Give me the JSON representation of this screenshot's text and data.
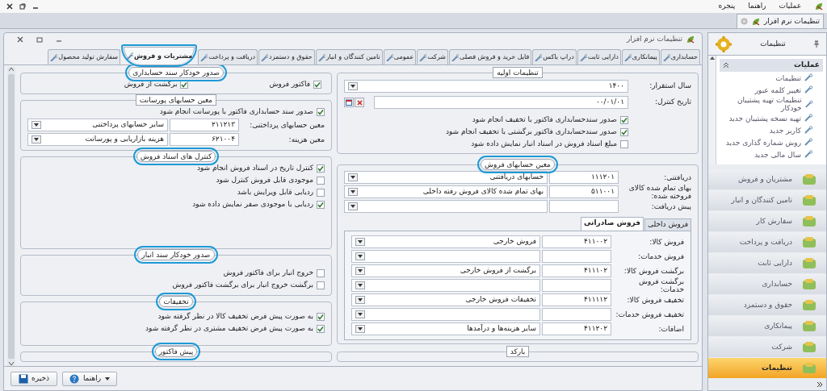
{
  "menu": [
    "عملیات",
    "راهنما",
    "پنجره"
  ],
  "doc_tab": {
    "title": "تنظیمات نرم افزار"
  },
  "window": {
    "title": "تنظیمات نرم افزار"
  },
  "tabs": [
    {
      "label": "حسابداری",
      "selected": false
    },
    {
      "label": "پیمانکاری",
      "selected": false
    },
    {
      "label": "دارایی ثابت",
      "selected": false
    },
    {
      "label": "دراپ باکس",
      "selected": false
    },
    {
      "label": "فایل خرید و فروش فصلی",
      "selected": false
    },
    {
      "label": "شرکت",
      "selected": false
    },
    {
      "label": "عمومی",
      "selected": false
    },
    {
      "label": "تامین کنندگان و انبار",
      "selected": false
    },
    {
      "label": "حقوق و دستمزد",
      "selected": false
    },
    {
      "label": "دریافت و پرداخت",
      "selected": false
    },
    {
      "label": "مشتریات و فروش",
      "selected": true,
      "highlighted": true
    },
    {
      "label": "سفارش تولید محصول",
      "selected": false
    }
  ],
  "initial_settings": {
    "legend": "تنظیمات اولیه",
    "highlighted": false,
    "fields": [
      {
        "kind": "dropdown",
        "label": "سال استقرار:",
        "value": "۱۴۰۰"
      },
      {
        "kind": "date",
        "label": "تاریخ کنترل:",
        "value": "۰۰/۰۱/۰۱"
      }
    ],
    "checks": [
      {
        "label": "صدور سندحسابداری فاکتور با تخفیف انجام شود",
        "checked": true
      },
      {
        "label": "صدور سندحسابداری فاکتور برگشتی با تخفیف انجام شود",
        "checked": true
      },
      {
        "label": "مبلغ اسناد فروش در اسناد انبار نمایش داده شود",
        "checked": false
      }
    ]
  },
  "sales_accounts": {
    "legend": "معین حسابهای فروش",
    "highlighted": true,
    "rows": [
      {
        "label": "دریافتنی:",
        "code": "۱۱۱۲۰۱",
        "name": "حسابهای دریافتنی"
      },
      {
        "label": "بهای تمام شده کالای فروخته شده:",
        "code": "۵۱۱۰۰۱",
        "name": "بهای تمام شده کالای فروش رفته داخلی"
      },
      {
        "label": "پیش دریافت:",
        "code": "",
        "name": ""
      }
    ],
    "subtabs": [
      {
        "label": "فروش داخلی",
        "selected": false
      },
      {
        "label": "فروش صادراتی",
        "selected": true
      }
    ],
    "export_rows": [
      {
        "label": "فروش کالا:",
        "code": "۴۱۱۰۰۲",
        "name": "فروش  خارجی"
      },
      {
        "label": "فروش خدمات:",
        "code": "",
        "name": ""
      },
      {
        "label": "برگشت فروش کالا:",
        "code": "۴۱۱۱۰۲",
        "name": "برگشت از فروش  خارجی"
      },
      {
        "label": "برگشت فروش خدمات:",
        "code": "",
        "name": ""
      },
      {
        "label": "تخفیف فروش کالا:",
        "code": "۴۱۱۱۱۲",
        "name": "تخفیفات فروش خارجی"
      },
      {
        "label": "تخفیف فروش خدمات:",
        "code": "",
        "name": ""
      },
      {
        "label": "اضافات:",
        "code": "۴۱۱۲۰۲",
        "name": "سایر هزینه‌ها و درآمدها"
      }
    ]
  },
  "barcode": {
    "legend": "بارکد",
    "highlighted": false
  },
  "auto_voucher": {
    "legend": "صدور خودکار سند حسابداری",
    "highlighted": true,
    "checks": [
      {
        "label": "فاکتور فروش",
        "checked": true
      },
      {
        "label": "برگشت از فروش",
        "checked": true
      }
    ]
  },
  "commission": {
    "legend": "معین حسابهای پورسانت",
    "highlighted": false,
    "checks": [
      {
        "label": "صدور سند حسابداری فاکتور با پورسانت انجام شود",
        "checked": true
      }
    ],
    "rows": [
      {
        "label": "معین حسابهای پرداختنی:",
        "code": "۲۱۱۲۱۳",
        "name": "سایر حسابهای پرداختنی"
      },
      {
        "label": "معین هزینه:",
        "code": "۶۲۱۰۰۴",
        "name": "هزینه بازاریابی و پورسانت"
      }
    ]
  },
  "sales_controls": {
    "legend": "کنترل های اسناد فروش",
    "highlighted": true,
    "checks": [
      {
        "label": "کنترل تاریخ در اسناد فروش انجام شود",
        "checked": true
      },
      {
        "label": "موجودی قابل فروش کنترل شود",
        "checked": false
      },
      {
        "label": "ردیابی قابل ویرایش باشد",
        "checked": false
      },
      {
        "label": "ردیابی با موجودی صفر نمایش داده شود",
        "checked": true
      }
    ]
  },
  "inventory_voucher": {
    "legend": "صدور خودکار سند انبار",
    "highlighted": true,
    "checks": [
      {
        "label": "خروج انبار برای فاکتور فروش",
        "checked": false
      },
      {
        "label": "برگشت خروج انبار برای برگشت فاکتور فروش",
        "checked": false
      }
    ]
  },
  "discounts": {
    "legend": "تخفیفات",
    "highlighted": true,
    "checks": [
      {
        "label": "به صورت پیش فرض تخفیف کالا در نظر گرفته شود",
        "checked": true
      },
      {
        "label": "به صورت پیش فرض تخفیف مشتری در نظر گرفته شود",
        "checked": true
      }
    ]
  },
  "proforma": {
    "legend": "پیش فاکتور",
    "highlighted": true
  },
  "buttons": [
    {
      "kind": "help",
      "label": "راهنما"
    },
    {
      "kind": "save",
      "label": "ذخیره"
    }
  ],
  "sidebar": {
    "title": "تنظیمات",
    "operations_header": "عملیات",
    "operations": [
      "تنظیمات",
      "تغییر کلمه عبور",
      "تنظیمات تهیه پشتیبان خودکار",
      "تهیه نسخه پشتیبان جدید",
      "کاربر جدید",
      "روش شماره گذاری جدید",
      "سال مالی جدید"
    ],
    "nav": [
      {
        "label": "مشتریان و فروش",
        "selected": false
      },
      {
        "label": "تامین کنندگان و انبار",
        "selected": false
      },
      {
        "label": "سفارش کار",
        "selected": false
      },
      {
        "label": "دریافت و پرداخت",
        "selected": false
      },
      {
        "label": "دارایی ثابت",
        "selected": false
      },
      {
        "label": "حسابداری",
        "selected": false
      },
      {
        "label": "حقوق و دستمزد",
        "selected": false
      },
      {
        "label": "پیمانکاری",
        "selected": false
      },
      {
        "label": "شرکت",
        "selected": false
      },
      {
        "label": "تنظیمات",
        "selected": true
      }
    ]
  }
}
